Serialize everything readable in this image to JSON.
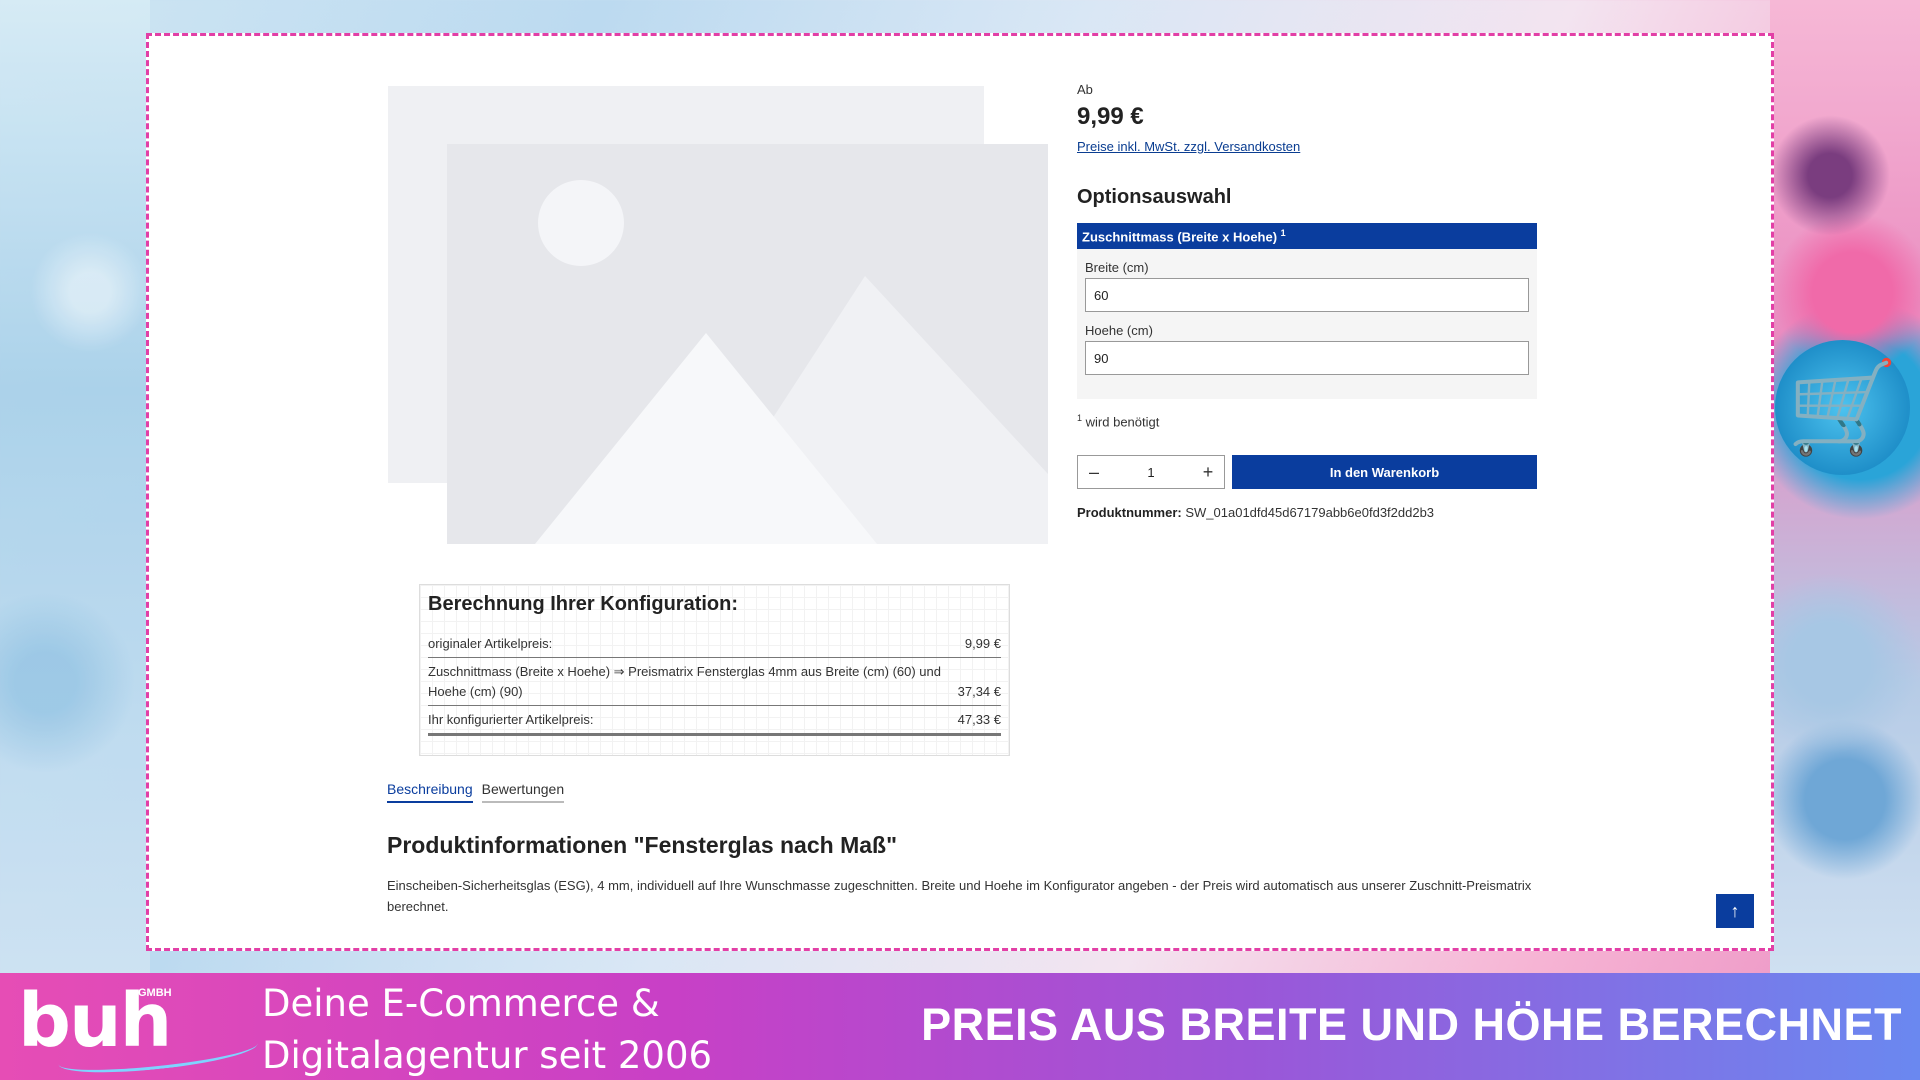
{
  "product": {
    "from_label": "Ab",
    "price": "9,99 €",
    "tax_link": "Preise inkl. MwSt. zzgl. Versandkosten",
    "options_title": "Optionsauswahl",
    "option_group": {
      "title": "Zuschnittmass (Breite x Hoehe)",
      "title_sup": "1",
      "fields": [
        {
          "label": "Breite (cm)",
          "value": "60"
        },
        {
          "label": "Hoehe (cm)",
          "value": "90"
        }
      ]
    },
    "required_sup": "1",
    "required_note": "wird benötigt",
    "quantity": "1",
    "qty_minus": "–",
    "qty_plus": "+",
    "add_to_cart": "In den Warenkorb",
    "product_number_label": "Produktnummer:",
    "product_number": "SW_01a01dfd45d67179abb6e0fd3f2dd2b3"
  },
  "calculation": {
    "title": "Berechnung Ihrer Konfiguration:",
    "rows": [
      {
        "label": "originaler Artikelpreis:",
        "value": "9,99 €"
      },
      {
        "label": "Zuschnittmass (Breite x Hoehe) ⇒ Preismatrix Fensterglas 4mm aus Breite (cm) (60) und Hoehe (cm) (90)",
        "value": "37,34 €"
      },
      {
        "label": "Ihr konfigurierter Artikelpreis:",
        "value": "47,33 €"
      }
    ]
  },
  "tabs": [
    "Beschreibung",
    "Bewertungen"
  ],
  "product_info": {
    "title": "Produktinformationen \"Fensterglas nach Maß\"",
    "text": "Einscheiben-Sicherheitsglas (ESG), 4 mm, individuell auf Ihre Wunschmasse zugeschnitten. Breite und Hoehe im Konfigurator angeben - der Preis wird automatisch aus unserer Zuschnitt-Preismatrix berechnet."
  },
  "scroll_top_icon": "arrow-up-icon",
  "banner": {
    "logo_text": "buh",
    "logo_suffix": "GMBH",
    "tagline_line1": "Deine E-Commerce &",
    "tagline_line2": "Digitalagentur seit 2006",
    "headline": "PREIS AUS BREITE UND HÖHE BERECHNET"
  },
  "colors": {
    "accent": "#0a3d9e",
    "frame_border": "#e23fa6",
    "banner_start": "#e64db5",
    "banner_end": "#6a88f0"
  }
}
